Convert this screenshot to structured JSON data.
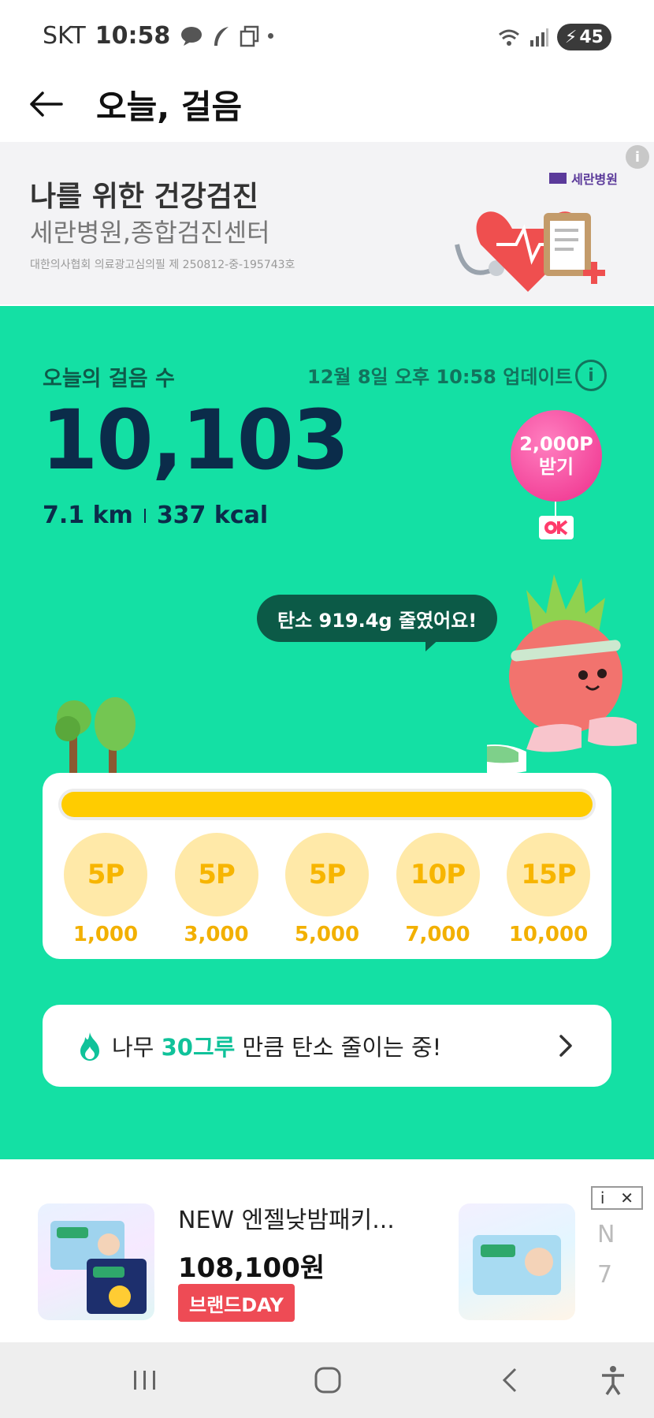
{
  "status_bar": {
    "carrier": "SKT",
    "time": "10:58",
    "battery": "45"
  },
  "header": {
    "title": "오늘, 걸음"
  },
  "top_ad": {
    "headline": "나를 위한 건강검진",
    "subline": "세란병원,종합검진센터",
    "notice": "대한의사협회 의료광고심의필 제 250812-중-195743호",
    "logo_text": "세란병원",
    "info_icon": "info-icon"
  },
  "steps": {
    "label": "오늘의 걸음 수",
    "updated": "12월 8일 오후 10:58 업데이트",
    "count": "10,103",
    "distance": "7.1 km",
    "calories": "337 kcal",
    "goal_progress": 1.0
  },
  "balloon": {
    "line1": "2,000P",
    "line2": "받기"
  },
  "carbon_message": "탄소 919.4g 줄였어요!",
  "rewards": [
    {
      "points": "5P",
      "steps": "1,000"
    },
    {
      "points": "5P",
      "steps": "3,000"
    },
    {
      "points": "5P",
      "steps": "5,000"
    },
    {
      "points": "10P",
      "steps": "7,000"
    },
    {
      "points": "15P",
      "steps": "10,000"
    }
  ],
  "tree_card": {
    "prefix": "나무 ",
    "highlight": "30그루",
    "suffix": " 만큼 탄소 줄이는 중!"
  },
  "bottom_ad": {
    "product_name": "NEW 엔젤낮밤패키...",
    "price": "108,100원",
    "badge": "브랜드DAY",
    "peek_line1": "N",
    "peek_line2": "7"
  },
  "colors": {
    "green_bg": "#14e0a4",
    "steps_text": "#0b2c4a",
    "progress": "#ffcc00",
    "reward_circle": "#ffe9a8",
    "balloon": "#ee2d8a",
    "badge": "#ee4b55"
  }
}
